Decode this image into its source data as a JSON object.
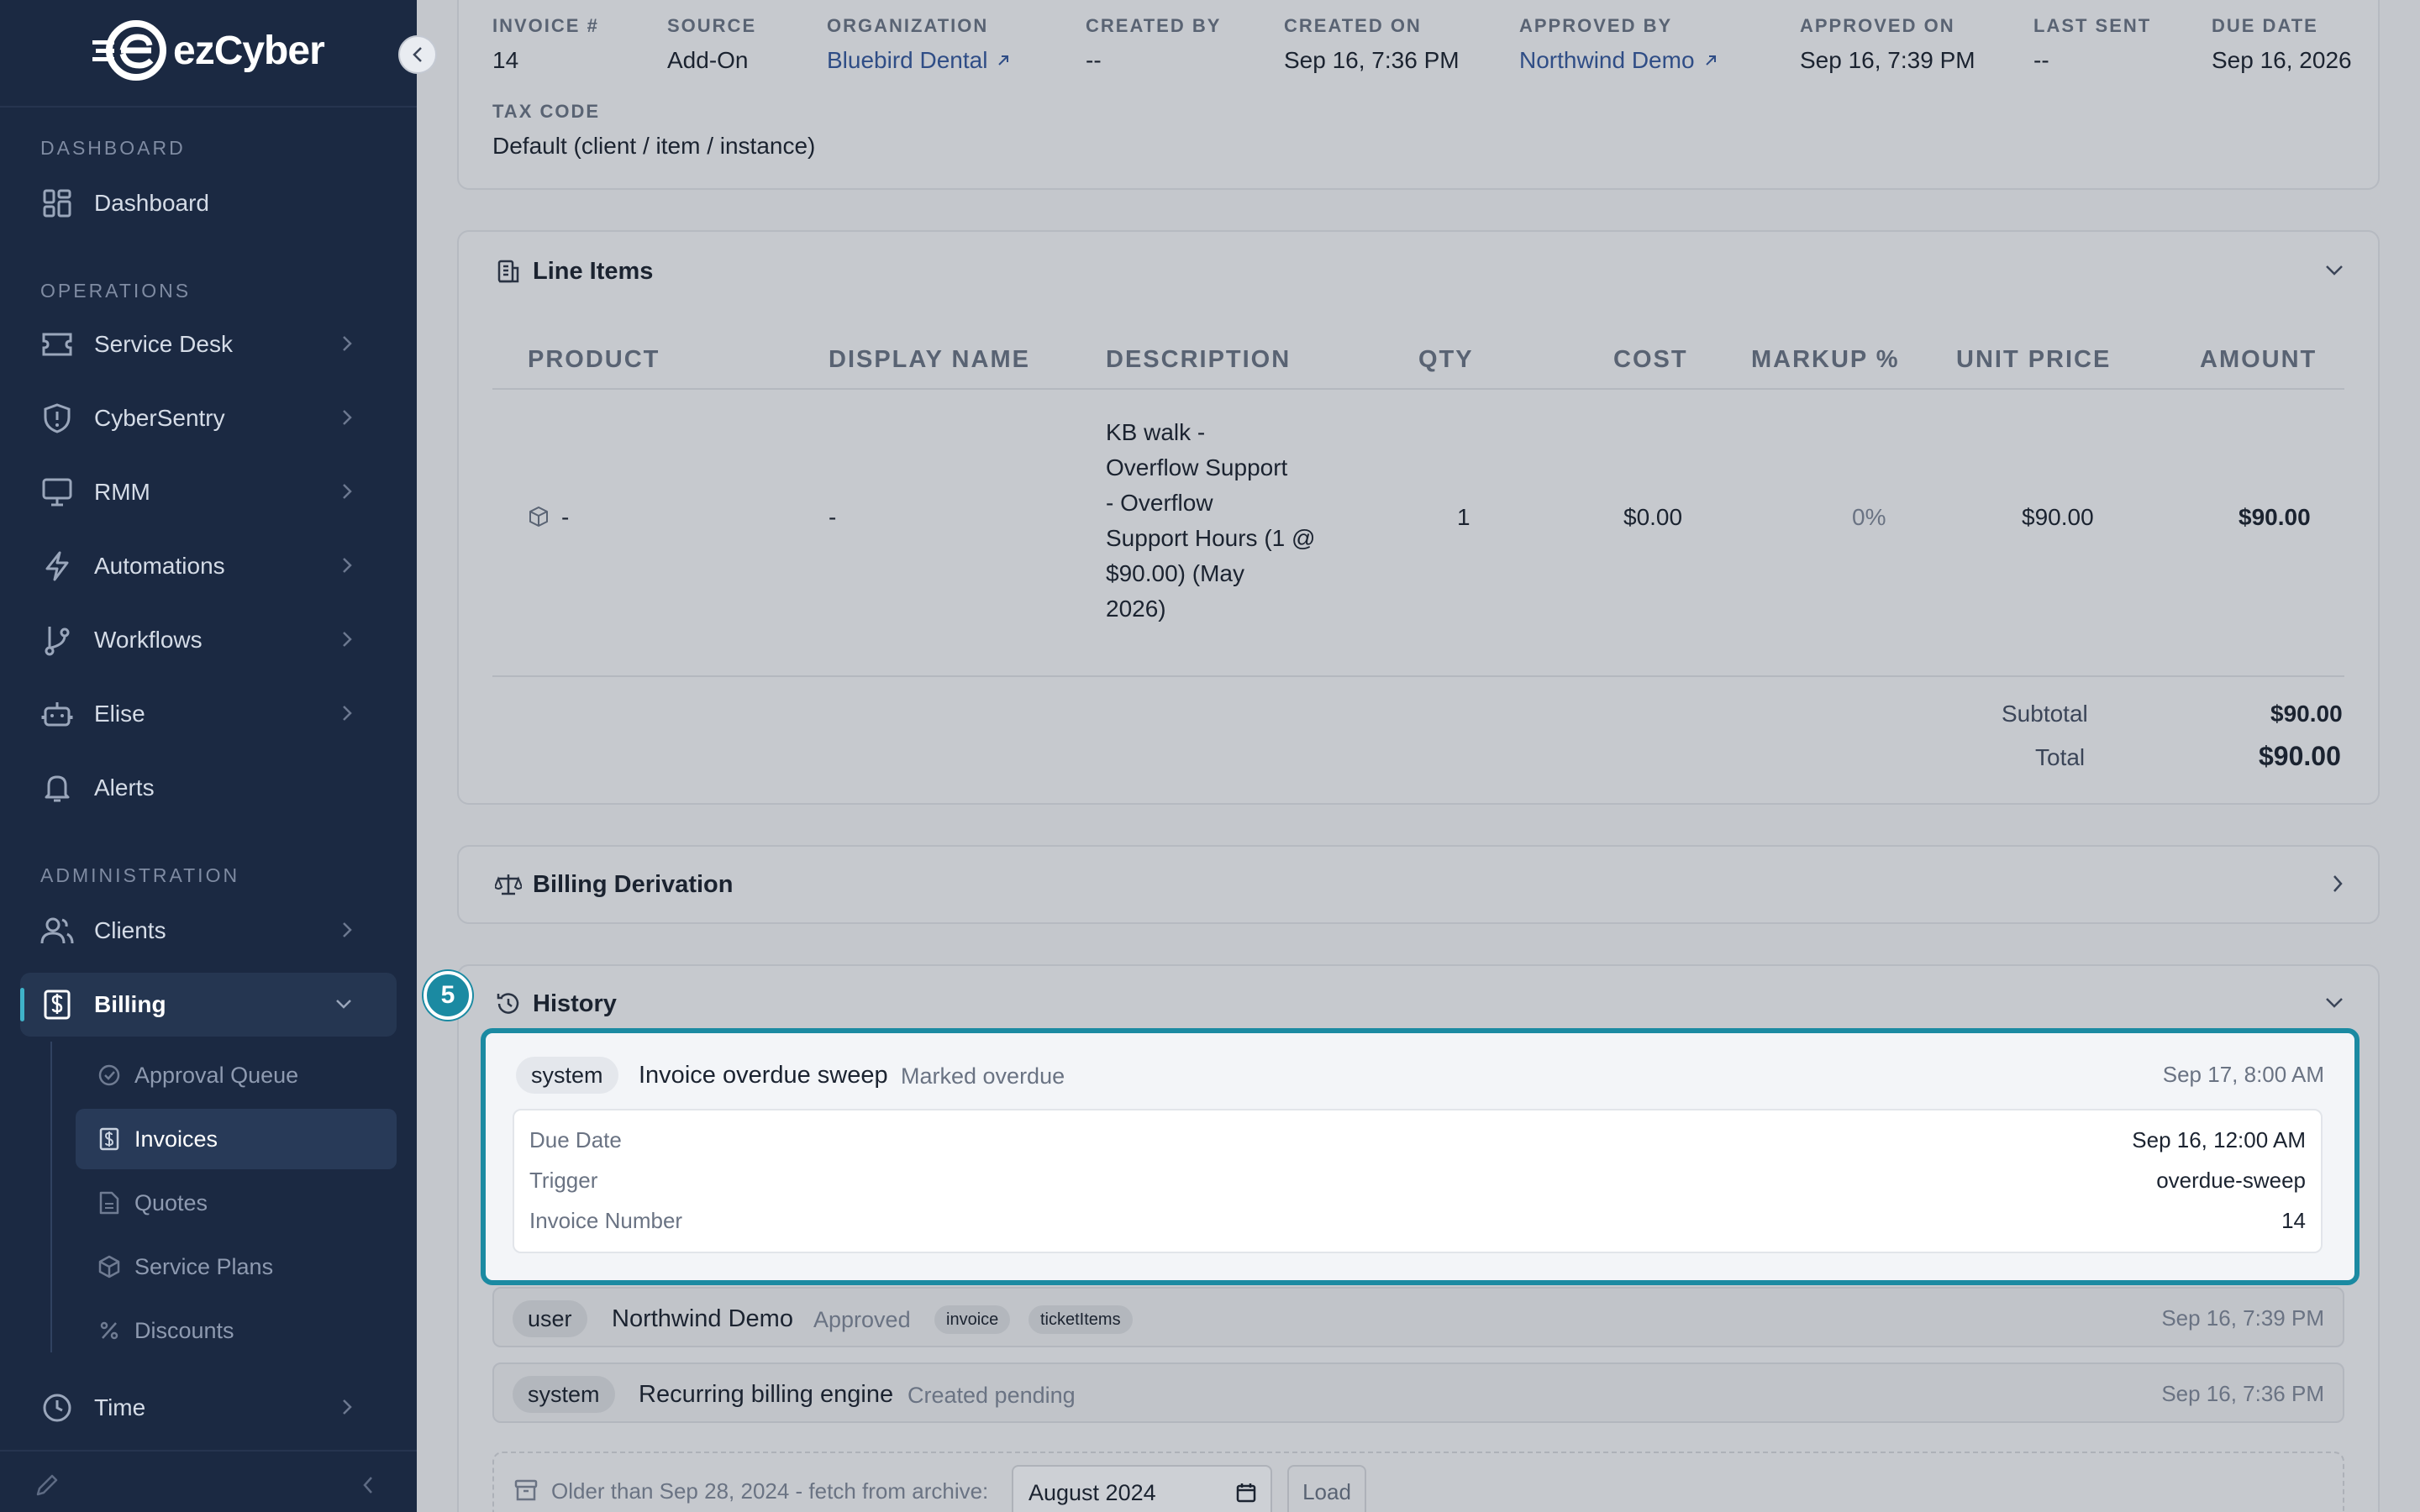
{
  "brand": {
    "logo_text": "ezCyber"
  },
  "sidebar": {
    "sections": {
      "dashboard": "DASHBOARD",
      "operations": "OPERATIONS",
      "administration": "ADMINISTRATION"
    },
    "items": {
      "dashboard": "Dashboard",
      "service_desk": "Service Desk",
      "cybersentry": "CyberSentry",
      "rmm": "RMM",
      "automations": "Automations",
      "workflows": "Workflows",
      "elise": "Elise",
      "alerts": "Alerts",
      "clients": "Clients",
      "billing": "Billing",
      "time": "Time"
    },
    "billing_sub": {
      "approval_queue": "Approval Queue",
      "invoices": "Invoices",
      "quotes": "Quotes",
      "service_plans": "Service Plans",
      "discounts": "Discounts"
    }
  },
  "invoice_meta": {
    "labels": {
      "invoice": "INVOICE #",
      "source": "SOURCE",
      "organization": "ORGANIZATION",
      "created_by": "CREATED BY",
      "created_on": "CREATED ON",
      "approved_by": "APPROVED BY",
      "approved_on": "APPROVED ON",
      "last_sent": "LAST SENT",
      "due_date": "DUE DATE",
      "tax_code": "TAX CODE"
    },
    "values": {
      "invoice": "14",
      "source": "Add-On",
      "organization": "Bluebird Dental",
      "created_by": "--",
      "created_on": "Sep 16, 7:36 PM",
      "approved_by": "Northwind Demo",
      "approved_on": "Sep 16, 7:39 PM",
      "last_sent": "--",
      "due_date": "Sep 16, 2026",
      "tax_code": "Default (client / item / instance)"
    }
  },
  "line_items": {
    "title": "Line Items",
    "columns": [
      "PRODUCT",
      "DISPLAY NAME",
      "DESCRIPTION",
      "QTY",
      "COST",
      "MARKUP %",
      "UNIT PRICE",
      "AMOUNT"
    ],
    "rows": [
      {
        "product": "-",
        "display_name": "-",
        "description_lines": [
          "KB walk -",
          "Overflow Support",
          "- Overflow",
          "Support Hours (1 @",
          "$90.00) (May",
          "2026)"
        ],
        "qty": "1",
        "cost": "$0.00",
        "markup": "0%",
        "unit_price": "$90.00",
        "amount": "$90.00"
      }
    ],
    "subtotal_label": "Subtotal",
    "subtotal": "$90.00",
    "total_label": "Total",
    "total": "$90.00"
  },
  "billing_derivation": {
    "title": "Billing Derivation"
  },
  "history": {
    "title": "History",
    "step_badge": "5",
    "entries": [
      {
        "type": "system",
        "actor": "Invoice overdue sweep",
        "action": "Marked overdue",
        "time": "Sep 17, 8:00 AM",
        "details": [
          {
            "key": "Due Date",
            "value": "Sep 16, 12:00 AM"
          },
          {
            "key": "Trigger",
            "value": "overdue-sweep"
          },
          {
            "key": "Invoice Number",
            "value": "14"
          }
        ]
      },
      {
        "type": "user",
        "actor": "Northwind Demo",
        "action": "Approved",
        "tags": [
          "invoice",
          "ticketItems"
        ],
        "time": "Sep 16, 7:39 PM"
      },
      {
        "type": "system",
        "actor": "Recurring billing engine",
        "action": "Created pending",
        "time": "Sep 16, 7:36 PM"
      }
    ],
    "archive": {
      "label": "Older than Sep 28, 2024 - fetch from archive:",
      "month_value": "August 2024",
      "load_button": "Load"
    }
  },
  "colors": {
    "sidebar_bg": "#1b2942",
    "accent": "#1b8aa2",
    "link": "#2f4d86"
  }
}
